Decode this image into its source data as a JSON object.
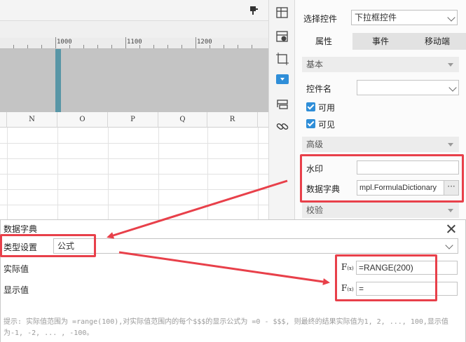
{
  "ruler": {
    "labels": [
      "1000",
      "1100",
      "1200"
    ]
  },
  "columns": [
    "N",
    "O",
    "P",
    "Q",
    "R"
  ],
  "icons": {
    "paint": "paint-bucket-icon",
    "strip": [
      "cell-attribute-icon",
      "widget-settings-icon",
      "float-element-icon",
      "dropdown-widget-icon",
      "condition-attribute-icon",
      "hyperlink-icon"
    ]
  },
  "panel": {
    "control_select_label": "选择控件",
    "control_select_value": "下拉框控件",
    "tabs": [
      "属性",
      "事件",
      "移动端"
    ],
    "section_basic": "基本",
    "widget_name_label": "控件名",
    "enabled_label": "可用",
    "visible_label": "可见",
    "section_advanced": "高级",
    "watermark_label": "水印",
    "dict_label": "数据字典",
    "dict_value": "mpl.FormulaDictionary",
    "dict_button": "···",
    "section_verify": "校验"
  },
  "dialog": {
    "title": "数据字典",
    "type_label": "类型设置",
    "type_value": "公式",
    "actual_label": "实际值",
    "display_label": "显示值",
    "fx_label": "F",
    "fx_sub": "(x)",
    "actual_value": "=RANGE(200)",
    "display_value": "=",
    "hint": "提示: 实际值范围为 =range(100),对实际值范围内的每个$$$的显示公式为 =0 - $$$, 则最终的结果实际值为1, 2, ..., 100,显示值为-1, -2, ... , -100。"
  },
  "colors": {
    "accent_blue": "#2f8ed8",
    "annotation_red": "#e8404a",
    "marker_teal": "#5896a6"
  }
}
